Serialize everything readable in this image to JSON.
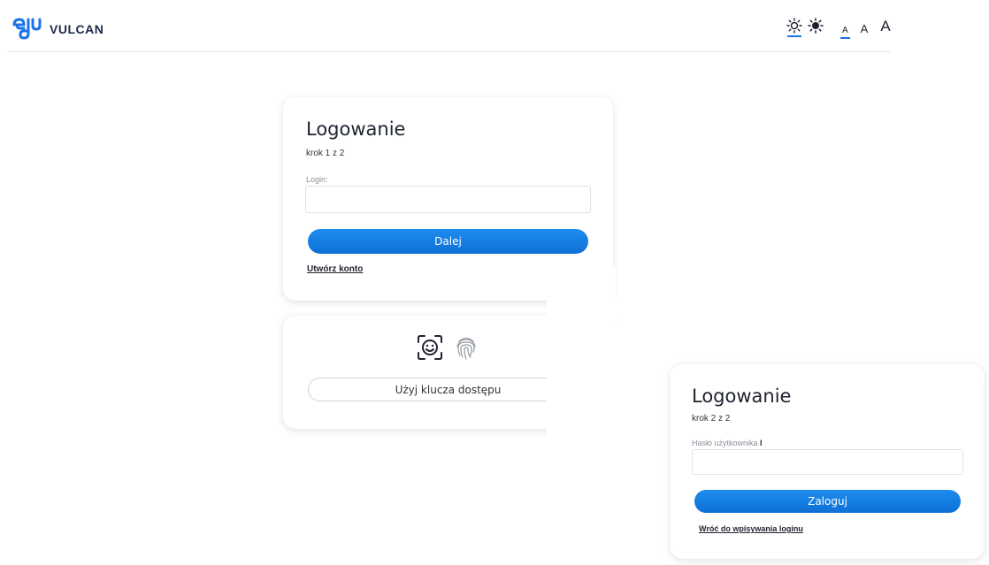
{
  "header": {
    "logo_text": "VULCAN",
    "logo_mark": "edu",
    "font_sizes": [
      "A",
      "A",
      "A"
    ]
  },
  "step1": {
    "title": "Logowanie",
    "step": "krok 1 z 2",
    "login_label": "Login:",
    "login_value": "",
    "next_button": "Dalej",
    "create_account_link": "Utwórz konto"
  },
  "passkey": {
    "button_label": "Użyj klucza dostępu",
    "icons": [
      "face-id-icon",
      "fingerprint-icon"
    ]
  },
  "step2": {
    "title": "Logowanie",
    "step": "krok 2 z 2",
    "password_label": "Hasło użytkownika",
    "password_value": "",
    "login_button": "Zaloguj",
    "back_link": "Wróć do wpisywania loginu"
  },
  "colors": {
    "accent": "#1a73e8",
    "button": "#0d6fd6"
  }
}
